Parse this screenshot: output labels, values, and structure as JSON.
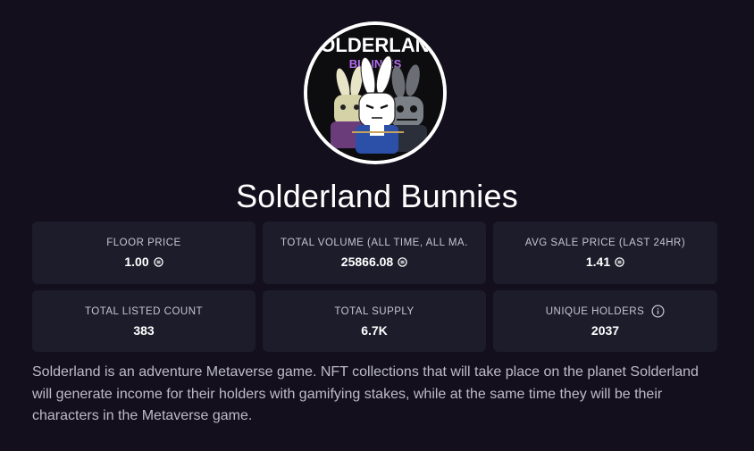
{
  "collection": {
    "logo_text_top": "SOLDERLAND",
    "logo_text_bottom": "BUNNIES",
    "name": "Solderland Bunnies"
  },
  "stats": [
    {
      "label": "FLOOR PRICE",
      "value": "1.00",
      "currency_icon": "sol-coin-icon"
    },
    {
      "label": "TOTAL VOLUME (ALL TIME, ALL MA...",
      "value": "25866.08",
      "currency_icon": "sol-coin-icon"
    },
    {
      "label": "AVG SALE PRICE (LAST 24HR)",
      "value": "1.41",
      "currency_icon": "sol-coin-icon"
    },
    {
      "label": "TOTAL LISTED COUNT",
      "value": "383"
    },
    {
      "label": "TOTAL SUPPLY",
      "value": "6.7K"
    },
    {
      "label": "UNIQUE HOLDERS",
      "value": "2037",
      "info_icon": "info-icon"
    }
  ],
  "description": "Solderland is an adventure Metaverse game. NFT collections that will take place on the planet Solderland will generate income for their holders with gamifying stakes, while at the same time they will be their characters in the Metaverse game.",
  "colors": {
    "background": "#130f1c",
    "card": "#1d1c2b",
    "label": "#c6c5d3",
    "text": "#ffffff",
    "description": "#bdbcc8",
    "logo_bottom": "#b56cf0"
  }
}
